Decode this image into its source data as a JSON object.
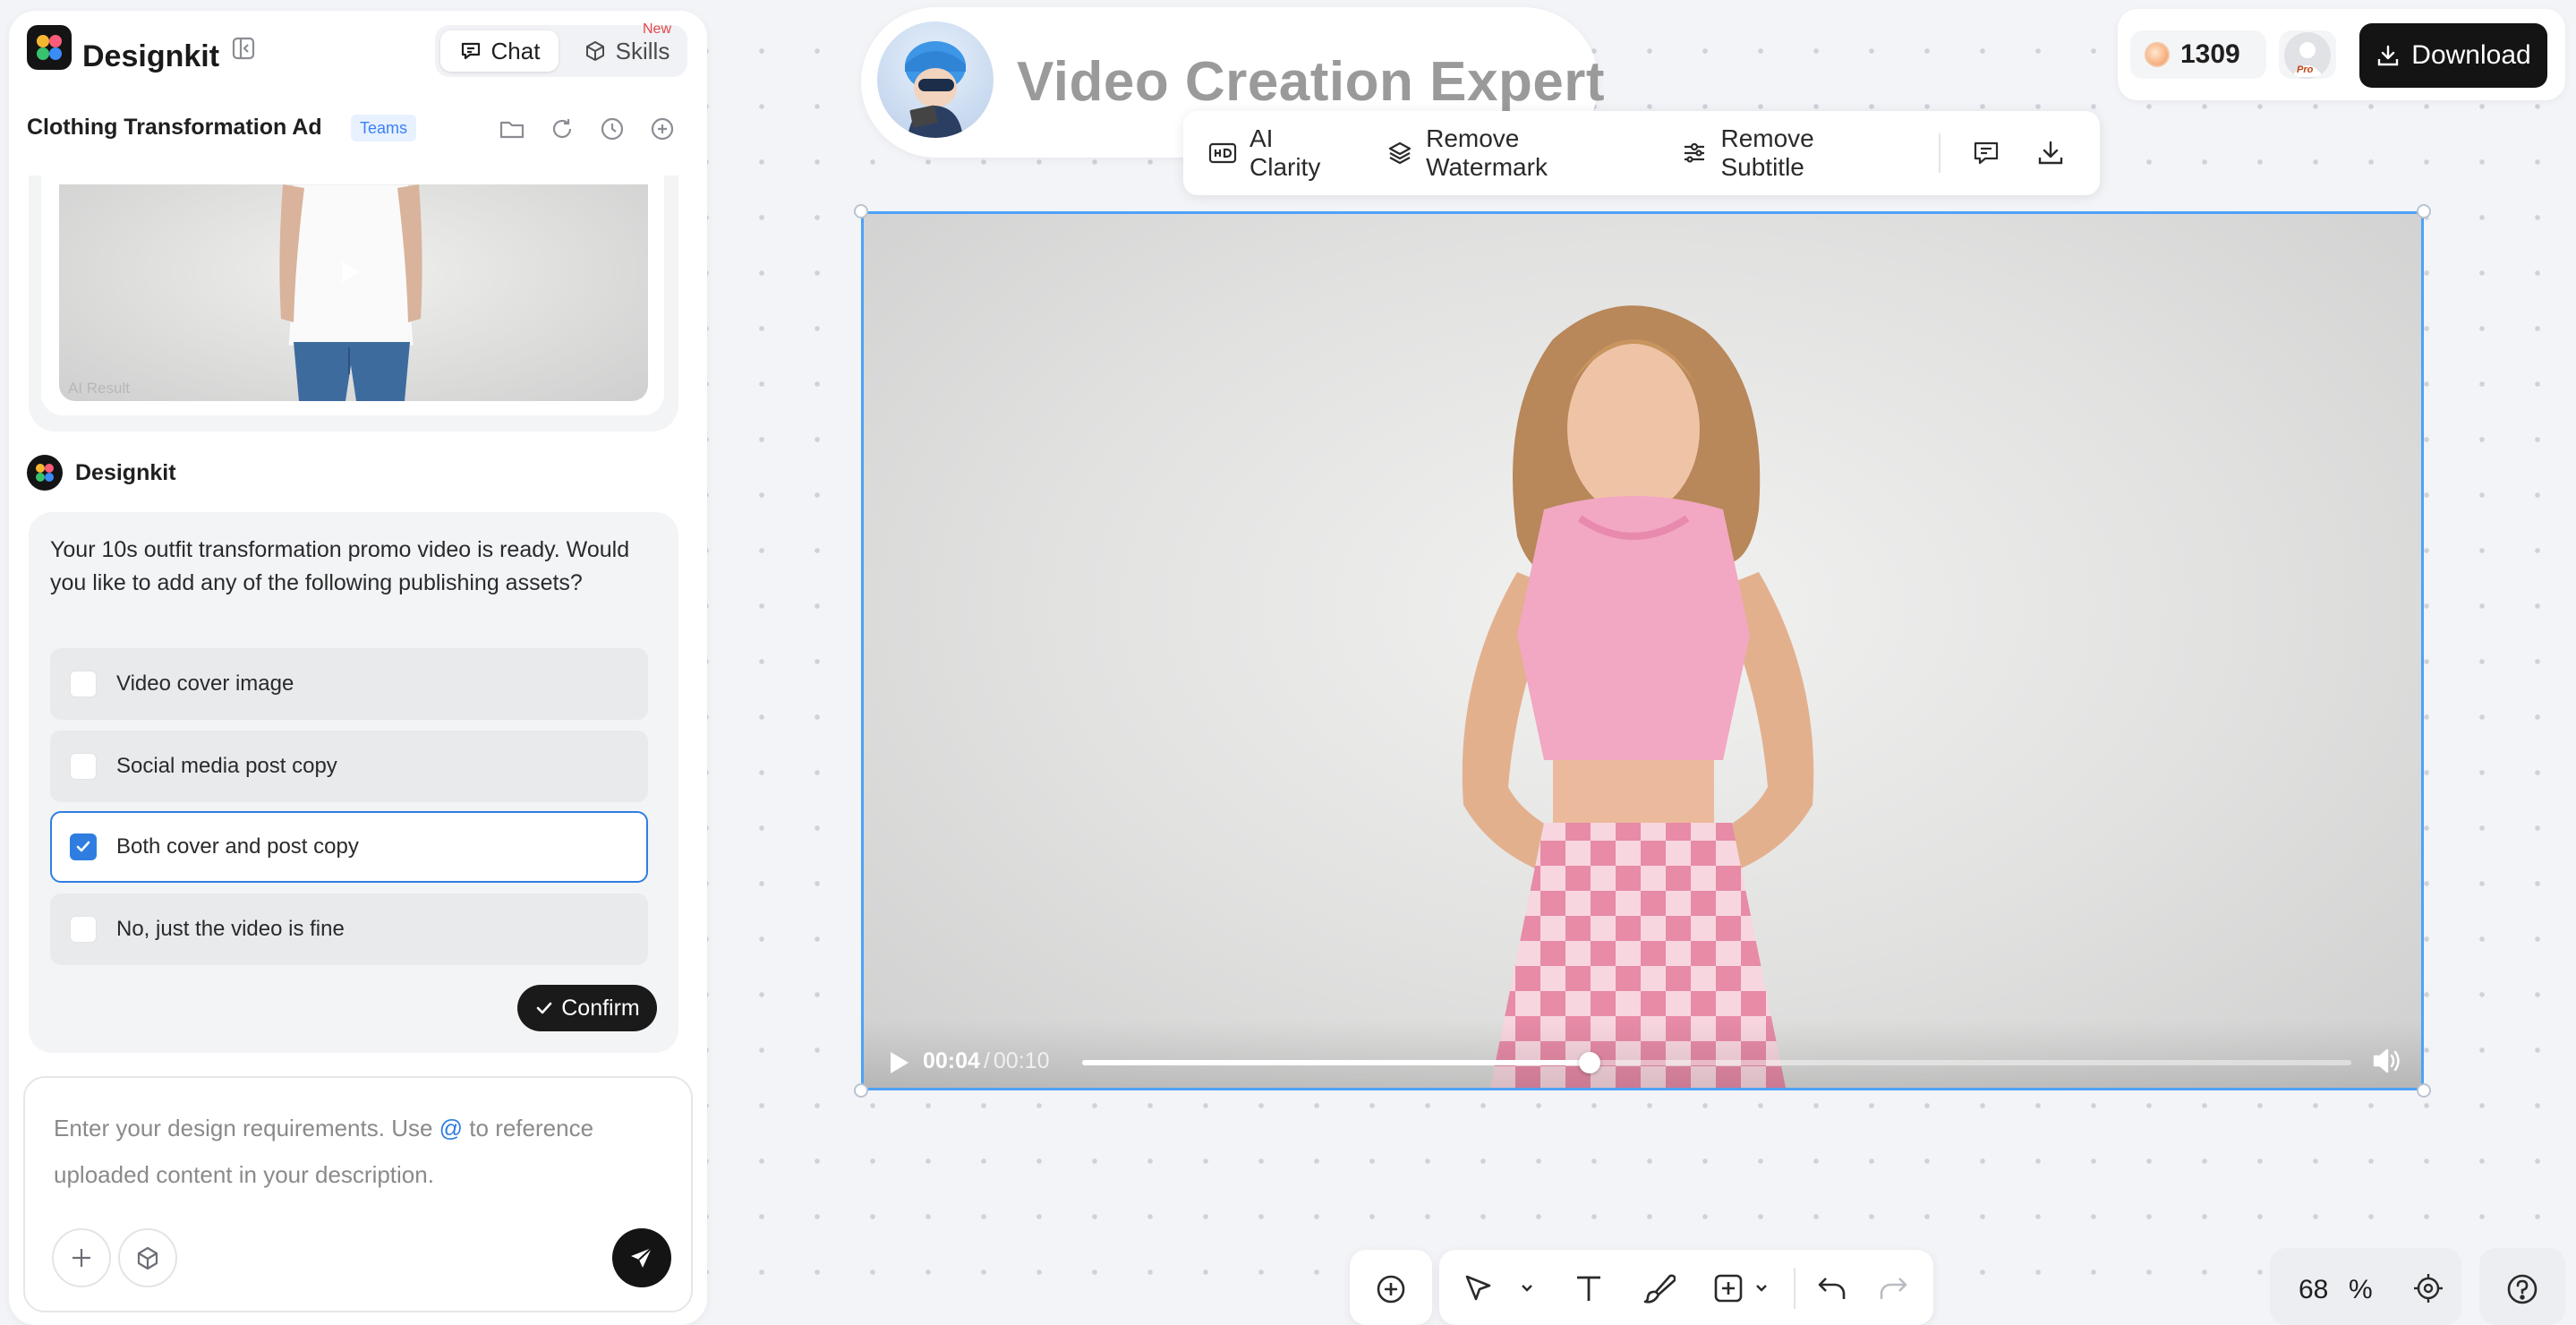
{
  "brand": {
    "name": "Designkit"
  },
  "header_tabs": {
    "chat": "Chat",
    "skills": "Skills",
    "new_badge": "New"
  },
  "project": {
    "title": "Clothing Transformation Ad",
    "badge": "Teams"
  },
  "preview": {
    "ai_result_label": "AI Result"
  },
  "bot": {
    "name": "Designkit"
  },
  "message": {
    "text": "Your 10s outfit transformation promo video is ready. Would you like to add any of the following publishing assets?",
    "options": [
      {
        "label": "Video cover image",
        "checked": false
      },
      {
        "label": "Social media post copy",
        "checked": false
      },
      {
        "label": "Both cover and post copy",
        "checked": true
      },
      {
        "label": "No, just the video is fine",
        "checked": false
      }
    ],
    "confirm_label": "Confirm"
  },
  "input": {
    "placeholder_before": "Enter your design requirements. Use ",
    "placeholder_at": "@",
    "placeholder_after": " to reference uploaded content in your description."
  },
  "agent": {
    "title": "Video Creation Expert"
  },
  "toolbar": {
    "ai_clarity": "AI Clarity",
    "remove_watermark": "Remove Watermark",
    "remove_subtitle": "Remove Subtitle"
  },
  "account": {
    "credits": "1309",
    "pro_tag": "Pro",
    "download_label": "Download"
  },
  "video": {
    "current_time": "00:04",
    "separator": "/",
    "duration": "00:10",
    "progress": 0.4
  },
  "zoom": {
    "value": "68",
    "unit": "%"
  },
  "colors": {
    "accent": "#2f7de1",
    "selection_border": "#4ea2f7",
    "dark": "#141414",
    "new_badge": "#e5484d"
  }
}
